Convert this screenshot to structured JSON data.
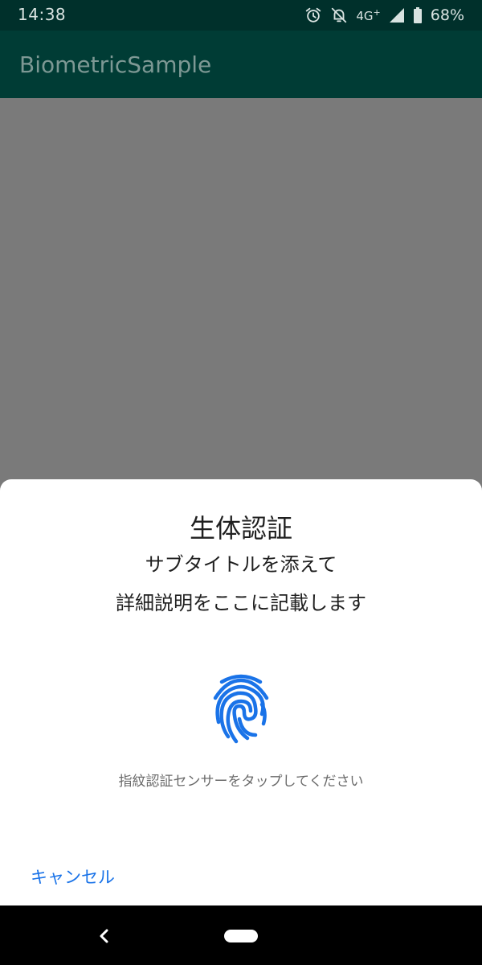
{
  "status_bar": {
    "time": "14:38",
    "network": "4G",
    "network_plus": "+",
    "battery_percent": "68%",
    "icons": [
      "alarm-icon",
      "notifications-off-icon",
      "signal-icon",
      "battery-icon"
    ]
  },
  "app_bar": {
    "title": "BiometricSample"
  },
  "dialog": {
    "title": "生体認証",
    "subtitle": "サブタイトルを添えて",
    "description": "詳細説明をここに記載します",
    "icon": "fingerprint-icon",
    "prompt": "指紋認証センサーをタップしてください",
    "negative_button": "キャンセル"
  },
  "colors": {
    "status_bar": "#00302b",
    "app_bar": "#003c35",
    "scrim": "#7a7a7a",
    "accent": "#1a73e8",
    "fingerprint": "#1a73e8"
  },
  "nav_bar": {
    "icons": [
      "back-icon",
      "home-pill"
    ]
  }
}
